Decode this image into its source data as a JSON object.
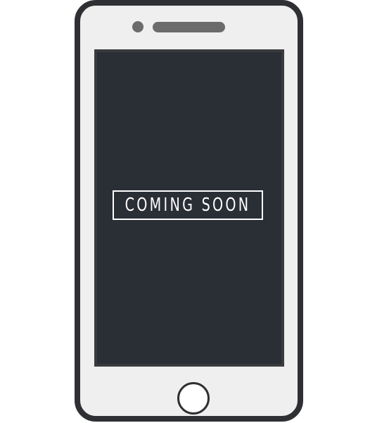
{
  "screen": {
    "banner_text": "COMING SOON"
  },
  "colors": {
    "phone_frame": "#2f3033",
    "phone_body": "#efefef",
    "screen_background": "#2a2e35",
    "banner_text": "#ffffff",
    "camera_speaker": "#6b6b6b"
  }
}
